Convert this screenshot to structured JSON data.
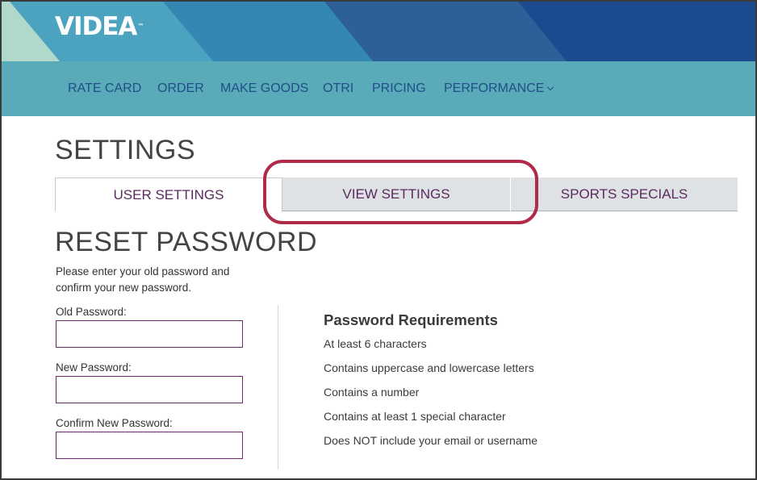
{
  "brand": {
    "logo_text": "VIDEA",
    "logo_mark": "™"
  },
  "nav": {
    "items": [
      {
        "label": "RATE CARD"
      },
      {
        "label": "ORDER"
      },
      {
        "label": "MAKE GOODS"
      },
      {
        "label": "OTRI"
      },
      {
        "label": "PRICING"
      },
      {
        "label": "PERFORMANCE"
      }
    ]
  },
  "page": {
    "title": "SETTINGS"
  },
  "tabs": [
    {
      "label": "USER SETTINGS",
      "active": true
    },
    {
      "label": "VIEW SETTINGS",
      "active": false,
      "highlighted": true
    },
    {
      "label": "SPORTS SPECIALS",
      "active": false
    }
  ],
  "reset": {
    "title": "RESET PASSWORD",
    "intro": "Please enter your old password and confirm your new password.",
    "fields": [
      {
        "label": "Old Password:",
        "value": "",
        "placeholder": ""
      },
      {
        "label": "New Password:",
        "value": "",
        "placeholder": ""
      },
      {
        "label": "Confirm New Password:",
        "value": "",
        "placeholder": ""
      }
    ]
  },
  "requirements": {
    "title": "Password Requirements",
    "items": [
      "At least 6 characters",
      "Contains uppercase and lowercase letters",
      "Contains a number",
      "Contains at least 1 special character",
      "Does NOT include your email or username"
    ]
  },
  "colors": {
    "nav_bg": "#5aabb9",
    "nav_text": "#1f4f86",
    "tab_text": "#5b2a5e",
    "input_border": "#6b2a6c",
    "highlight": "#b02a4a"
  }
}
